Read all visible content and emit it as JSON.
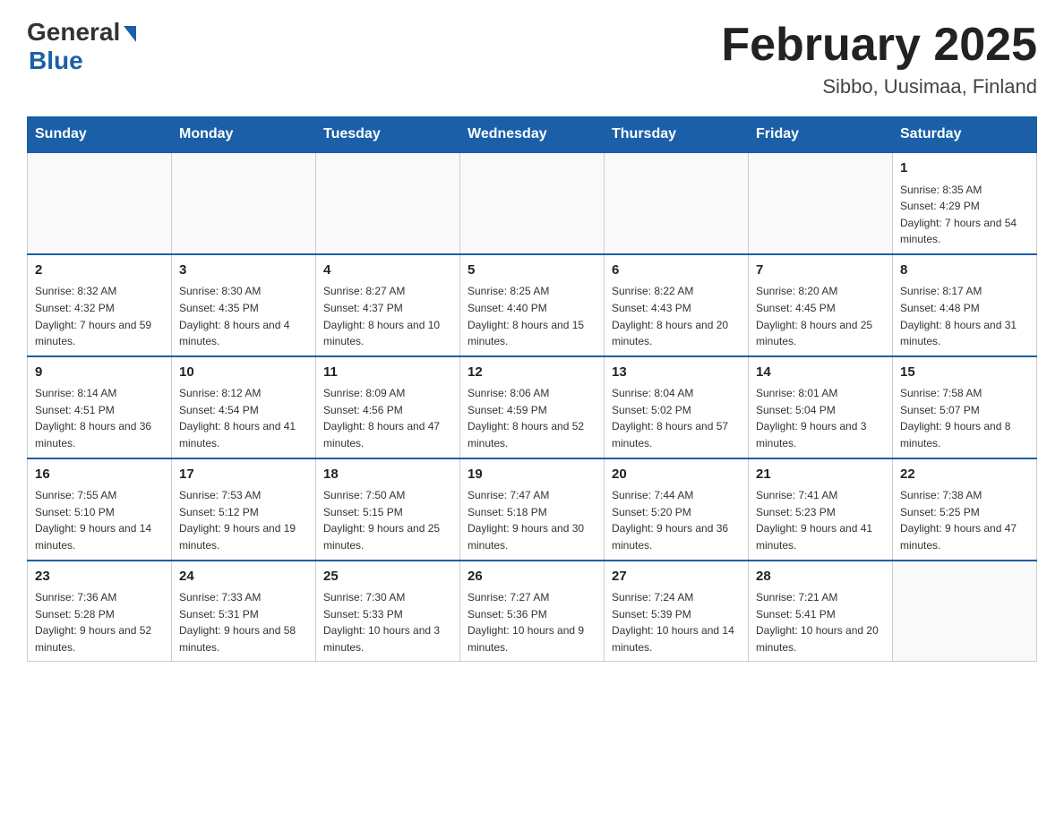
{
  "header": {
    "logo_general": "General",
    "logo_blue": "Blue",
    "month_title": "February 2025",
    "location": "Sibbo, Uusimaa, Finland"
  },
  "days_of_week": [
    "Sunday",
    "Monday",
    "Tuesday",
    "Wednesday",
    "Thursday",
    "Friday",
    "Saturday"
  ],
  "weeks": [
    [
      {
        "day": "",
        "sunrise": "",
        "sunset": "",
        "daylight": ""
      },
      {
        "day": "",
        "sunrise": "",
        "sunset": "",
        "daylight": ""
      },
      {
        "day": "",
        "sunrise": "",
        "sunset": "",
        "daylight": ""
      },
      {
        "day": "",
        "sunrise": "",
        "sunset": "",
        "daylight": ""
      },
      {
        "day": "",
        "sunrise": "",
        "sunset": "",
        "daylight": ""
      },
      {
        "day": "",
        "sunrise": "",
        "sunset": "",
        "daylight": ""
      },
      {
        "day": "1",
        "sunrise": "Sunrise: 8:35 AM",
        "sunset": "Sunset: 4:29 PM",
        "daylight": "Daylight: 7 hours and 54 minutes."
      }
    ],
    [
      {
        "day": "2",
        "sunrise": "Sunrise: 8:32 AM",
        "sunset": "Sunset: 4:32 PM",
        "daylight": "Daylight: 7 hours and 59 minutes."
      },
      {
        "day": "3",
        "sunrise": "Sunrise: 8:30 AM",
        "sunset": "Sunset: 4:35 PM",
        "daylight": "Daylight: 8 hours and 4 minutes."
      },
      {
        "day": "4",
        "sunrise": "Sunrise: 8:27 AM",
        "sunset": "Sunset: 4:37 PM",
        "daylight": "Daylight: 8 hours and 10 minutes."
      },
      {
        "day": "5",
        "sunrise": "Sunrise: 8:25 AM",
        "sunset": "Sunset: 4:40 PM",
        "daylight": "Daylight: 8 hours and 15 minutes."
      },
      {
        "day": "6",
        "sunrise": "Sunrise: 8:22 AM",
        "sunset": "Sunset: 4:43 PM",
        "daylight": "Daylight: 8 hours and 20 minutes."
      },
      {
        "day": "7",
        "sunrise": "Sunrise: 8:20 AM",
        "sunset": "Sunset: 4:45 PM",
        "daylight": "Daylight: 8 hours and 25 minutes."
      },
      {
        "day": "8",
        "sunrise": "Sunrise: 8:17 AM",
        "sunset": "Sunset: 4:48 PM",
        "daylight": "Daylight: 8 hours and 31 minutes."
      }
    ],
    [
      {
        "day": "9",
        "sunrise": "Sunrise: 8:14 AM",
        "sunset": "Sunset: 4:51 PM",
        "daylight": "Daylight: 8 hours and 36 minutes."
      },
      {
        "day": "10",
        "sunrise": "Sunrise: 8:12 AM",
        "sunset": "Sunset: 4:54 PM",
        "daylight": "Daylight: 8 hours and 41 minutes."
      },
      {
        "day": "11",
        "sunrise": "Sunrise: 8:09 AM",
        "sunset": "Sunset: 4:56 PM",
        "daylight": "Daylight: 8 hours and 47 minutes."
      },
      {
        "day": "12",
        "sunrise": "Sunrise: 8:06 AM",
        "sunset": "Sunset: 4:59 PM",
        "daylight": "Daylight: 8 hours and 52 minutes."
      },
      {
        "day": "13",
        "sunrise": "Sunrise: 8:04 AM",
        "sunset": "Sunset: 5:02 PM",
        "daylight": "Daylight: 8 hours and 57 minutes."
      },
      {
        "day": "14",
        "sunrise": "Sunrise: 8:01 AM",
        "sunset": "Sunset: 5:04 PM",
        "daylight": "Daylight: 9 hours and 3 minutes."
      },
      {
        "day": "15",
        "sunrise": "Sunrise: 7:58 AM",
        "sunset": "Sunset: 5:07 PM",
        "daylight": "Daylight: 9 hours and 8 minutes."
      }
    ],
    [
      {
        "day": "16",
        "sunrise": "Sunrise: 7:55 AM",
        "sunset": "Sunset: 5:10 PM",
        "daylight": "Daylight: 9 hours and 14 minutes."
      },
      {
        "day": "17",
        "sunrise": "Sunrise: 7:53 AM",
        "sunset": "Sunset: 5:12 PM",
        "daylight": "Daylight: 9 hours and 19 minutes."
      },
      {
        "day": "18",
        "sunrise": "Sunrise: 7:50 AM",
        "sunset": "Sunset: 5:15 PM",
        "daylight": "Daylight: 9 hours and 25 minutes."
      },
      {
        "day": "19",
        "sunrise": "Sunrise: 7:47 AM",
        "sunset": "Sunset: 5:18 PM",
        "daylight": "Daylight: 9 hours and 30 minutes."
      },
      {
        "day": "20",
        "sunrise": "Sunrise: 7:44 AM",
        "sunset": "Sunset: 5:20 PM",
        "daylight": "Daylight: 9 hours and 36 minutes."
      },
      {
        "day": "21",
        "sunrise": "Sunrise: 7:41 AM",
        "sunset": "Sunset: 5:23 PM",
        "daylight": "Daylight: 9 hours and 41 minutes."
      },
      {
        "day": "22",
        "sunrise": "Sunrise: 7:38 AM",
        "sunset": "Sunset: 5:25 PM",
        "daylight": "Daylight: 9 hours and 47 minutes."
      }
    ],
    [
      {
        "day": "23",
        "sunrise": "Sunrise: 7:36 AM",
        "sunset": "Sunset: 5:28 PM",
        "daylight": "Daylight: 9 hours and 52 minutes."
      },
      {
        "day": "24",
        "sunrise": "Sunrise: 7:33 AM",
        "sunset": "Sunset: 5:31 PM",
        "daylight": "Daylight: 9 hours and 58 minutes."
      },
      {
        "day": "25",
        "sunrise": "Sunrise: 7:30 AM",
        "sunset": "Sunset: 5:33 PM",
        "daylight": "Daylight: 10 hours and 3 minutes."
      },
      {
        "day": "26",
        "sunrise": "Sunrise: 7:27 AM",
        "sunset": "Sunset: 5:36 PM",
        "daylight": "Daylight: 10 hours and 9 minutes."
      },
      {
        "day": "27",
        "sunrise": "Sunrise: 7:24 AM",
        "sunset": "Sunset: 5:39 PM",
        "daylight": "Daylight: 10 hours and 14 minutes."
      },
      {
        "day": "28",
        "sunrise": "Sunrise: 7:21 AM",
        "sunset": "Sunset: 5:41 PM",
        "daylight": "Daylight: 10 hours and 20 minutes."
      },
      {
        "day": "",
        "sunrise": "",
        "sunset": "",
        "daylight": ""
      }
    ]
  ]
}
